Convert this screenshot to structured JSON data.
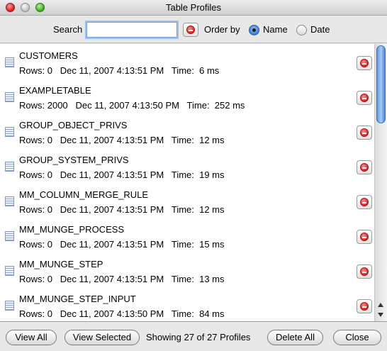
{
  "window": {
    "title": "Table Profiles"
  },
  "toolbar": {
    "search_label": "Search",
    "search_value": "",
    "order_by_label": "Order by",
    "order_options": [
      {
        "label": "Name",
        "selected": true
      },
      {
        "label": "Date",
        "selected": false
      }
    ]
  },
  "profiles": [
    {
      "name": "CUSTOMERS",
      "info": "Rows: 0   Dec 11, 2007 4:13:51 PM   Time:  6 ms"
    },
    {
      "name": "EXAMPLETABLE",
      "info": "Rows: 2000   Dec 11, 2007 4:13:50 PM   Time:  252 ms"
    },
    {
      "name": "GROUP_OBJECT_PRIVS",
      "info": "Rows: 0   Dec 11, 2007 4:13:51 PM   Time:  12 ms"
    },
    {
      "name": "GROUP_SYSTEM_PRIVS",
      "info": "Rows: 0   Dec 11, 2007 4:13:51 PM   Time:  19 ms"
    },
    {
      "name": "MM_COLUMN_MERGE_RULE",
      "info": "Rows: 0   Dec 11, 2007 4:13:51 PM   Time:  12 ms"
    },
    {
      "name": "MM_MUNGE_PROCESS",
      "info": "Rows: 0   Dec 11, 2007 4:13:51 PM   Time:  15 ms"
    },
    {
      "name": "MM_MUNGE_STEP",
      "info": "Rows: 0   Dec 11, 2007 4:13:51 PM   Time:  13 ms"
    },
    {
      "name": "MM_MUNGE_STEP_INPUT",
      "info": "Rows: 0   Dec 11, 2007 4:13:50 PM   Time:  84 ms"
    }
  ],
  "bottom": {
    "view_all": "View All",
    "view_selected": "View Selected",
    "status": "Showing 27 of 27 Profiles",
    "delete_all": "Delete All",
    "close": "Close"
  }
}
